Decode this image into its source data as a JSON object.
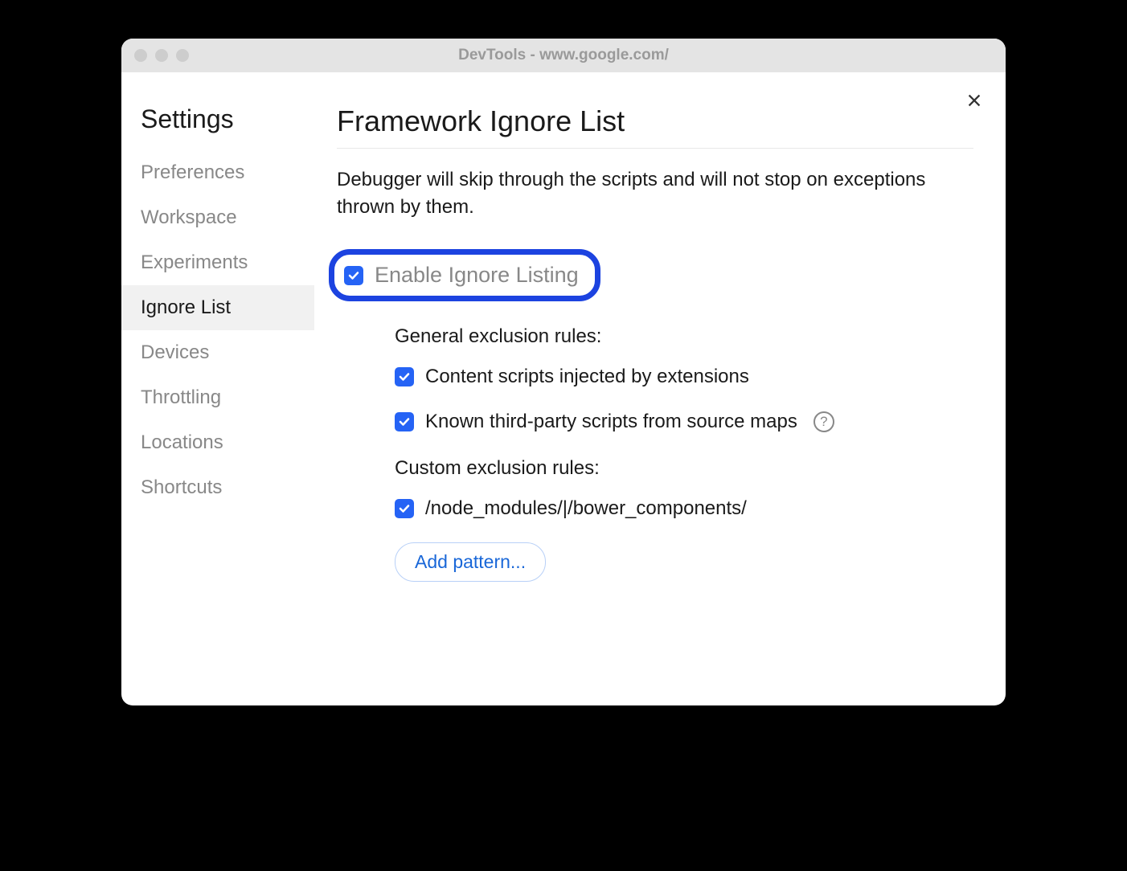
{
  "titlebar": {
    "title": "DevTools - www.google.com/"
  },
  "sidebar": {
    "title": "Settings",
    "items": [
      {
        "label": "Preferences",
        "selected": false
      },
      {
        "label": "Workspace",
        "selected": false
      },
      {
        "label": "Experiments",
        "selected": false
      },
      {
        "label": "Ignore List",
        "selected": true
      },
      {
        "label": "Devices",
        "selected": false
      },
      {
        "label": "Throttling",
        "selected": false
      },
      {
        "label": "Locations",
        "selected": false
      },
      {
        "label": "Shortcuts",
        "selected": false
      }
    ]
  },
  "main": {
    "title": "Framework Ignore List",
    "description": "Debugger will skip through the scripts and will not stop on exceptions thrown by them.",
    "enable_checkbox": {
      "label": "Enable Ignore Listing",
      "checked": true
    },
    "general_section": {
      "title": "General exclusion rules:",
      "rules": [
        {
          "label": "Content scripts injected by extensions",
          "checked": true,
          "help": false
        },
        {
          "label": "Known third-party scripts from source maps",
          "checked": true,
          "help": true
        }
      ]
    },
    "custom_section": {
      "title": "Custom exclusion rules:",
      "rules": [
        {
          "label": "/node_modules/|/bower_components/",
          "checked": true
        }
      ]
    },
    "add_pattern_label": "Add pattern..."
  }
}
